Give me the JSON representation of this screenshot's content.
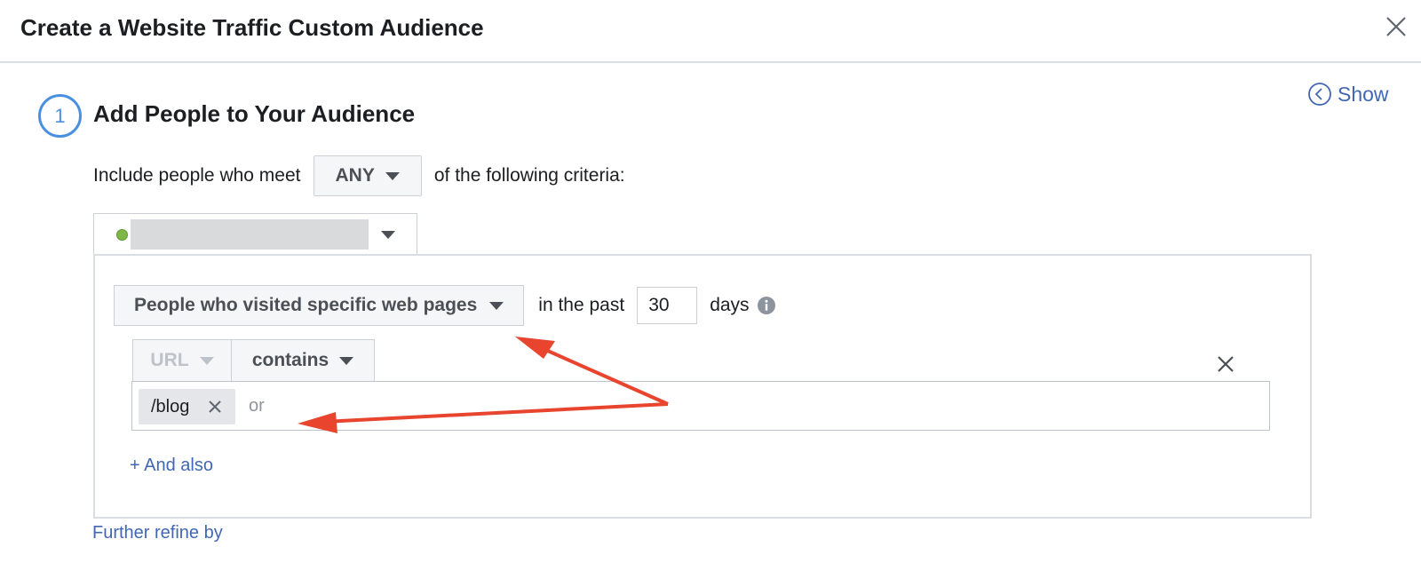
{
  "header": {
    "title": "Create a Website Traffic Custom Audience"
  },
  "show_link": {
    "label": "Show",
    "icon": "chevron-left-circle-icon"
  },
  "step": {
    "number": "1",
    "title": "Add People to Your Audience"
  },
  "criteria": {
    "prefix": "Include people who meet",
    "match": "ANY",
    "suffix": "of the following criteria:"
  },
  "pixel": {
    "status_color": "#7fb648"
  },
  "rule": {
    "type": "People who visited specific web pages",
    "in_past_label": "in the past",
    "days_value": "30",
    "days_label": "days",
    "field": "URL",
    "operator": "contains",
    "tags": [
      "/blog"
    ],
    "or_label": "or"
  },
  "links": {
    "and_also": "+ And also",
    "further_refine": "Further refine by"
  },
  "colors": {
    "link": "#4267b2",
    "step_ring": "#4a90e2",
    "annotation_arrow": "#e8442e"
  }
}
